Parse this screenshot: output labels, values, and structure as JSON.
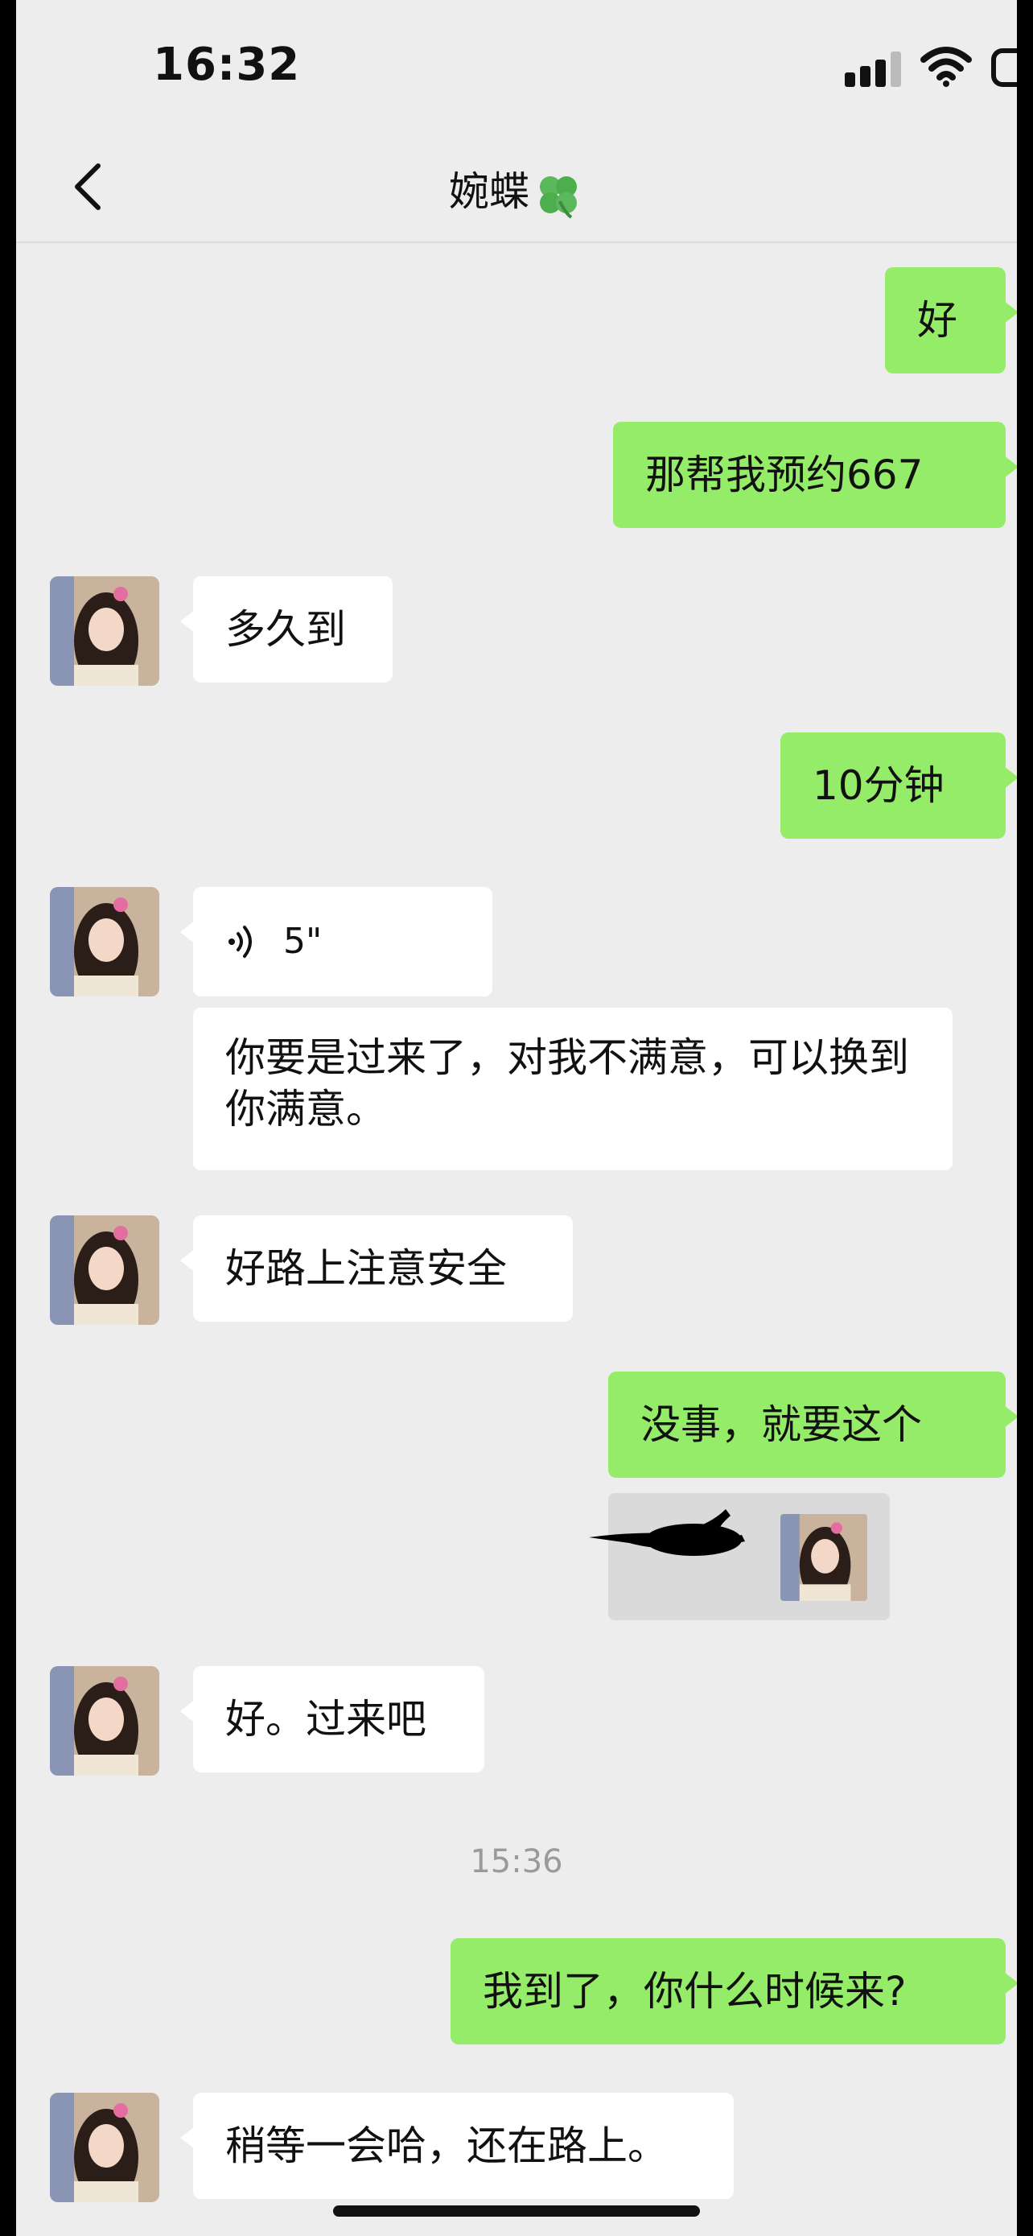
{
  "status_bar": {
    "time": "16:32"
  },
  "header": {
    "title": "婉蝶"
  },
  "messages": [
    {
      "side": "out",
      "text": "好"
    },
    {
      "side": "out",
      "text": "那帮我预约667"
    },
    {
      "side": "in",
      "text": "多久到"
    },
    {
      "side": "out",
      "text": "10分钟"
    },
    {
      "side": "in",
      "type": "voice",
      "duration": "5\""
    },
    {
      "side": "in",
      "text": "你要是过来了，对我不满意，可以换到你满意。"
    },
    {
      "side": "in",
      "text": "好路上注意安全"
    },
    {
      "side": "out",
      "text": "没事，就要这个"
    },
    {
      "side": "in",
      "text": "好。过来吧"
    },
    {
      "side": "out",
      "text": "我到了，你什么时候来?"
    },
    {
      "side": "in",
      "text": "稍等一会哈，还在路上。"
    }
  ],
  "timestamp": "15:36",
  "colors": {
    "outgoing_bubble": "#95ec69",
    "incoming_bubble": "#ffffff",
    "background": "#ededed"
  }
}
